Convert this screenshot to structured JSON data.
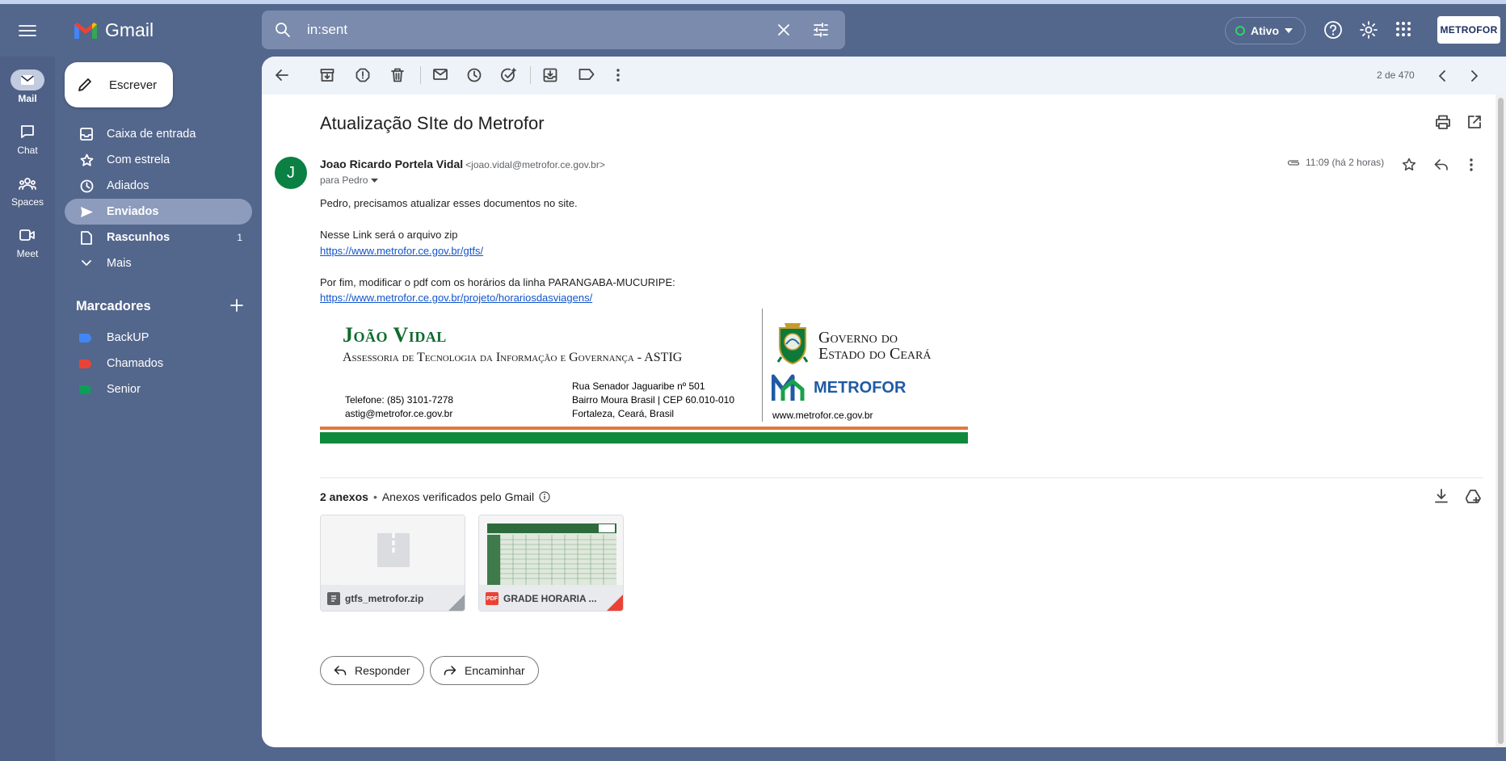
{
  "app": {
    "name": "Gmail"
  },
  "rail": {
    "items": [
      {
        "label": "Mail",
        "icon": "mail-icon",
        "active": true
      },
      {
        "label": "Chat",
        "icon": "chat-icon",
        "active": false
      },
      {
        "label": "Spaces",
        "icon": "spaces-icon",
        "active": false
      },
      {
        "label": "Meet",
        "icon": "video-icon",
        "active": false
      }
    ]
  },
  "search": {
    "value": "in:sent"
  },
  "status": {
    "label": "Ativo",
    "color": "#2fd36b"
  },
  "account": {
    "badge": "METROFOR"
  },
  "compose": {
    "label": "Escrever"
  },
  "nav": {
    "items": [
      {
        "label": "Caixa de entrada",
        "icon": "inbox-icon"
      },
      {
        "label": "Com estrela",
        "icon": "star-icon"
      },
      {
        "label": "Adiados",
        "icon": "clock-icon"
      },
      {
        "label": "Enviados",
        "icon": "send-icon",
        "active": true
      },
      {
        "label": "Rascunhos",
        "icon": "draft-icon",
        "count": "1"
      },
      {
        "label": "Mais",
        "icon": "chevron-down-icon"
      }
    ]
  },
  "labels": {
    "title": "Marcadores",
    "items": [
      {
        "label": "BackUP",
        "color": "#4285f4"
      },
      {
        "label": "Chamados",
        "color": "#ea4335"
      },
      {
        "label": "Senior",
        "color": "#0f9d58"
      }
    ]
  },
  "toolbar": {
    "pager": "2 de 470"
  },
  "email": {
    "subject": "Atualização SIte do Metrofor",
    "avatar_letter": "J",
    "sender_name": "Joao Ricardo Portela Vidal",
    "sender_email": "<joao.vidal@metrofor.ce.gov.br>",
    "to": "para Pedro",
    "time": "11:09 (há 2 horas)",
    "body": {
      "line1": "Pedro, precisamos atualizar esses documentos no site.",
      "line2": "Nesse Link será o arquivo zip",
      "link1": "https://www.metrofor.ce.gov.br/gtfs/",
      "line3": "Por fim, modificar o pdf com os horários da linha PARANGABA-MUCURIPE:",
      "link2": "https://www.metrofor.ce.gov.br/projeto/horariosdasviagens/"
    }
  },
  "signature": {
    "name": "João Vidal",
    "dept": "Assessoria de Tecnologia da Informação e Governança - ASTIG",
    "address": [
      "Rua Senador Jaguaribe nº 501",
      "Bairro Moura Brasil | CEP 60.010-010",
      "Fortaleza, Ceará, Brasil"
    ],
    "phone": "Telefone: (85) 3101-7278",
    "email": "astig@metrofor.ce.gov.br",
    "gov_line1": "Governo do",
    "gov_line2": "Estado do Ceará",
    "metro": "METROFOR",
    "site": "www.metrofor.ce.gov.br"
  },
  "attachments": {
    "count_label": "2 anexos",
    "verified": "Anexos verificados pelo Gmail",
    "files": [
      {
        "name": "gtfs_metrofor.zip",
        "type": "zip"
      },
      {
        "name": "GRADE HORARIA ...",
        "type": "pdf",
        "badge": "PDF"
      }
    ]
  },
  "actions": {
    "reply": "Responder",
    "forward": "Encaminhar"
  }
}
